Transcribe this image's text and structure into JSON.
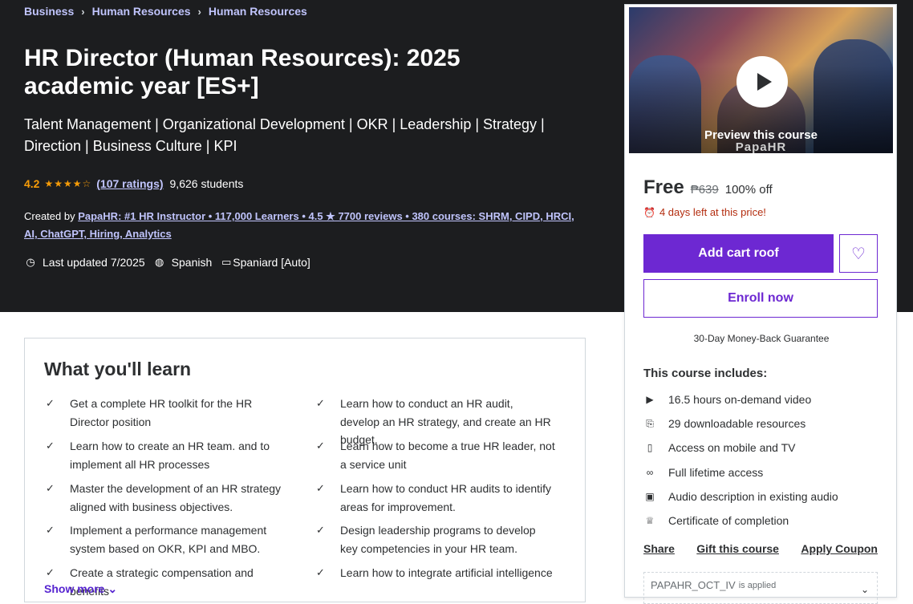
{
  "breadcrumb": [
    "Business",
    "Human Resources",
    "Human Resources"
  ],
  "course": {
    "title": "HR Director (Human Resources): 2025 academic year [ES+]",
    "subtitle": "Talent Management | Organizational Development | OKR | Leadership | Strategy | Direction | Business Culture | KPI",
    "rating": "4.2",
    "stars_value": 4.2,
    "ratings_link": "(107 ratings)",
    "students": "9,626 students",
    "created_by_label": "Created by",
    "instructor": "PapaHR: #1 HR Instructor • 117,000 Learners • 4.5 ★ 7700 reviews • 380 courses: SHRM, CIPD, HRCI, AI, ChatGPT, Hiring, Analytics",
    "last_updated": "Last updated 7/2025",
    "language": "Spanish",
    "captions": "Spaniard [Auto]"
  },
  "learn": {
    "title": "What you'll learn",
    "items": [
      "Get a complete HR toolkit for the HR Director position",
      "Learn how to conduct an HR audit, develop an HR strategy, and create an HR budget.",
      "Learn how to create an HR team. and to implement all HR processes",
      "Learn how to become a true HR leader, not a service unit",
      "Master the development of an HR strategy aligned with business objectives.",
      "Learn how to conduct HR audits to identify areas for improvement.",
      "Implement a performance management system based on OKR, KPI and MBO.",
      "Design leadership programs to develop key competencies in your HR team.",
      "Create a strategic compensation and benefits",
      "Learn how to integrate artificial intelligence"
    ],
    "show_more": "Show more ⌄"
  },
  "sidebar": {
    "preview_label": "Preview this course",
    "brand": "PapaHR",
    "price": "Free",
    "original_price": "₱639",
    "discount": "100% off",
    "timer": "4 days left at this price!",
    "add_cart": "Add cart roof",
    "enroll": "Enroll now",
    "guarantee": "30-Day Money-Back Guarantee",
    "includes_title": "This course includes:",
    "includes": [
      {
        "icon": "video-icon",
        "text": "16.5 hours on-demand video"
      },
      {
        "icon": "file-download-icon",
        "text": "29 downloadable resources"
      },
      {
        "icon": "mobile-icon",
        "text": "Access on mobile and TV"
      },
      {
        "icon": "infinity-icon",
        "text": "Full lifetime access"
      },
      {
        "icon": "audio-description-icon",
        "text": "Audio description in existing audio"
      },
      {
        "icon": "trophy-icon",
        "text": "Certificate of completion"
      }
    ],
    "share": "Share",
    "gift": "Gift this course",
    "apply_coupon": "Apply Coupon",
    "coupon_code": "PAPAHR_OCT_IV",
    "coupon_status": "is applied"
  },
  "colors": {
    "hero_bg": "#1c1d1f",
    "accent_purple": "#6d28d2",
    "link_lavender": "#c0c4fc",
    "star": "#f69c08",
    "timer_red": "#b32d0f"
  }
}
